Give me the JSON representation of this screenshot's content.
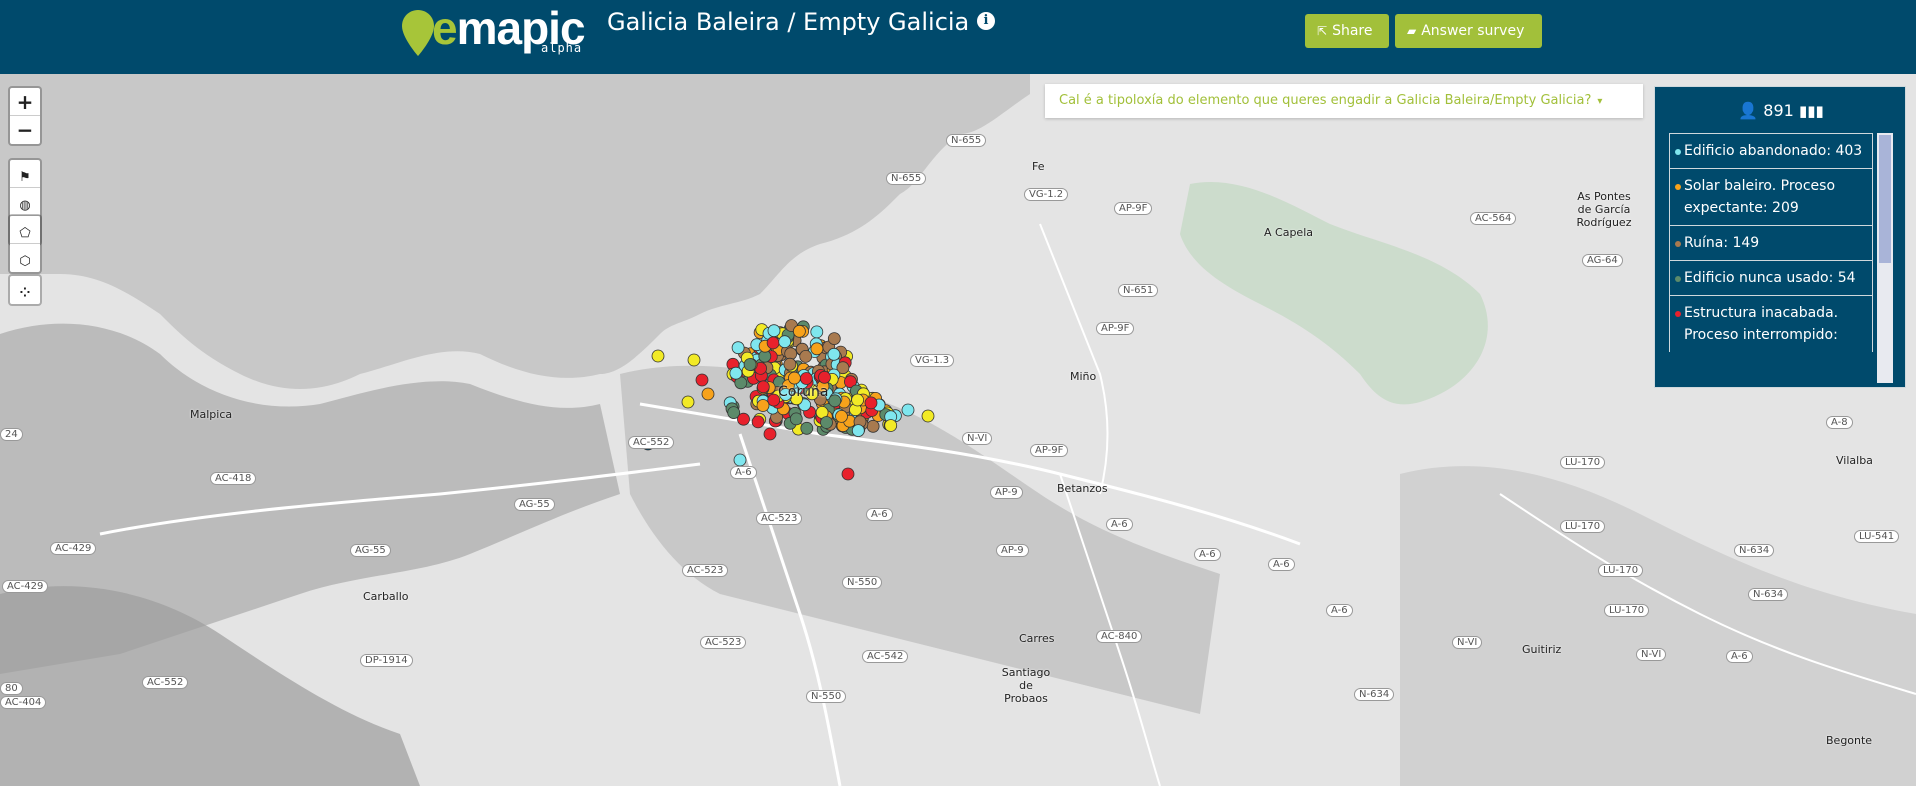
{
  "header": {
    "logo_text": "mapic",
    "logo_prefix": "e",
    "logo_sub": "alpha",
    "title": "Galicia Baleira / Empty Galicia",
    "info_icon": "i",
    "share_label": "Share",
    "answer_label": "Answer survey"
  },
  "colors": {
    "header_bg": "#004a6c",
    "accent": "#a2c03a"
  },
  "map_controls": {
    "zoom_in": "+",
    "zoom_out": "−"
  },
  "question": {
    "text": "Cal é a tipoloxía do elemento que queres engadir a Galicia Baleira/Empty Galicia?"
  },
  "legend": {
    "count": "891",
    "items": [
      {
        "label": "Edificio abandonado: 403",
        "color": "#7fe6ee"
      },
      {
        "label": "Solar baleiro. Proceso expectante: 209",
        "color": "#f7a21b"
      },
      {
        "label": "Ruína: 149",
        "color": "#a87a4f"
      },
      {
        "label": "Edificio nunca usado: 54",
        "color": "#5c8a6a"
      },
      {
        "label": "Estructura inacabada. Proceso interrompido:",
        "color": "#e8212c"
      }
    ]
  },
  "places": [
    {
      "name": "Malpica"
    },
    {
      "name": "Carballo"
    },
    {
      "name": "Betanzos"
    },
    {
      "name": "Miño"
    },
    {
      "name": "A Capela"
    },
    {
      "name": "As Pontes de García Rodríguez"
    },
    {
      "name": "Vilalba"
    },
    {
      "name": "Guitiriz"
    },
    {
      "name": "Carres"
    },
    {
      "name": "Santiago de Probaos"
    },
    {
      "name": "Begonte"
    },
    {
      "name": "Coruña"
    },
    {
      "name": "Fe"
    }
  ],
  "roads": [
    {
      "name": "N-655"
    },
    {
      "name": "N-655"
    },
    {
      "name": "VG-1.2"
    },
    {
      "name": "AP-9F"
    },
    {
      "name": "AC-564"
    },
    {
      "name": "AG-64"
    },
    {
      "name": "N-651"
    },
    {
      "name": "AP-9F"
    },
    {
      "name": "VG-1.3"
    },
    {
      "name": "N-VI"
    },
    {
      "name": "AP-9F"
    },
    {
      "name": "AC-552"
    },
    {
      "name": "A-6"
    },
    {
      "name": "AC-418"
    },
    {
      "name": "AG-55"
    },
    {
      "name": "AC-523"
    },
    {
      "name": "A-6"
    },
    {
      "name": "AP-9"
    },
    {
      "name": "A-6"
    },
    {
      "name": "AC-429"
    },
    {
      "name": "AG-55"
    },
    {
      "name": "AP-9"
    },
    {
      "name": "A-6"
    },
    {
      "name": "A-6"
    },
    {
      "name": "AC-429"
    },
    {
      "name": "AC-523"
    },
    {
      "name": "N-550"
    },
    {
      "name": "A-6"
    },
    {
      "name": "LU-170"
    },
    {
      "name": "LU-170"
    },
    {
      "name": "LU-170"
    },
    {
      "name": "LU-170"
    },
    {
      "name": "N-634"
    },
    {
      "name": "N-634"
    },
    {
      "name": "LU-541"
    },
    {
      "name": "A-8"
    },
    {
      "name": "DP-1914"
    },
    {
      "name": "AC-523"
    },
    {
      "name": "AC-542"
    },
    {
      "name": "AC-840"
    },
    {
      "name": "N-VI"
    },
    {
      "name": "N-VI"
    },
    {
      "name": "AC-552"
    },
    {
      "name": "N-550"
    },
    {
      "name": "N-634"
    },
    {
      "name": "A-6"
    },
    {
      "name": "AC-404"
    },
    {
      "name": "24"
    },
    {
      "name": "80"
    }
  ]
}
